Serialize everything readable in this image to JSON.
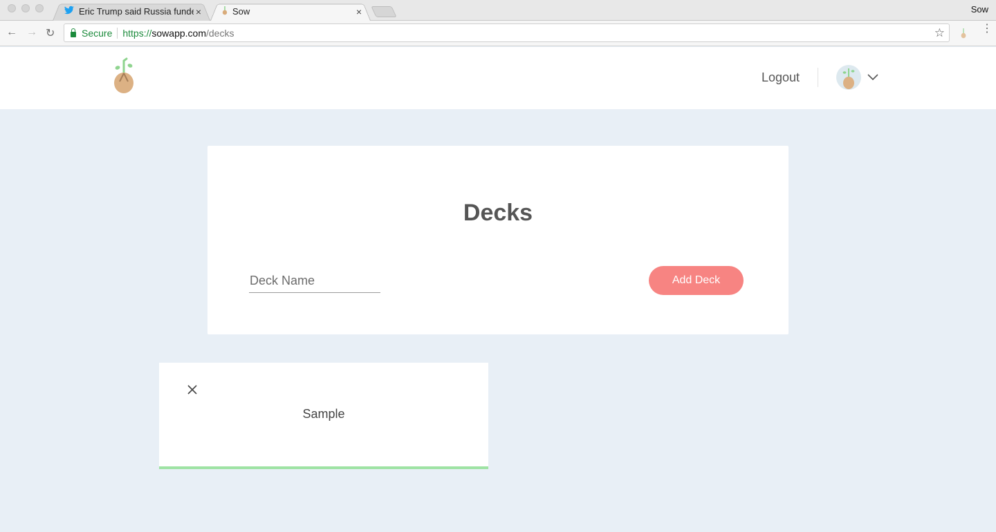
{
  "browser": {
    "tabs": [
      {
        "title": "Eric Trump said Russia funded",
        "icon": "twitter-bird-icon"
      },
      {
        "title": "Sow",
        "icon": "sow-sprout-icon",
        "active": true
      }
    ],
    "tab_close": "×",
    "profile_name": "Sow",
    "secure_label": "Secure",
    "url": {
      "scheme": "https://",
      "host": "sowapp.com",
      "path": "/decks"
    },
    "back": "←",
    "forward": "→",
    "reload": "↻",
    "bookmark": "☆",
    "menu": "⋮"
  },
  "header": {
    "logout_label": "Logout"
  },
  "decks_panel": {
    "title": "Decks",
    "input_placeholder": "Deck Name",
    "input_value": "",
    "add_button_label": "Add Deck"
  },
  "decks": [
    {
      "name": "Sample",
      "close_icon": "close-icon"
    }
  ],
  "colors": {
    "page_bg": "#e8eff6",
    "accent_button": "#f78482",
    "card_bar": "#9ee3a4",
    "secure_green": "#1b8a3b"
  }
}
